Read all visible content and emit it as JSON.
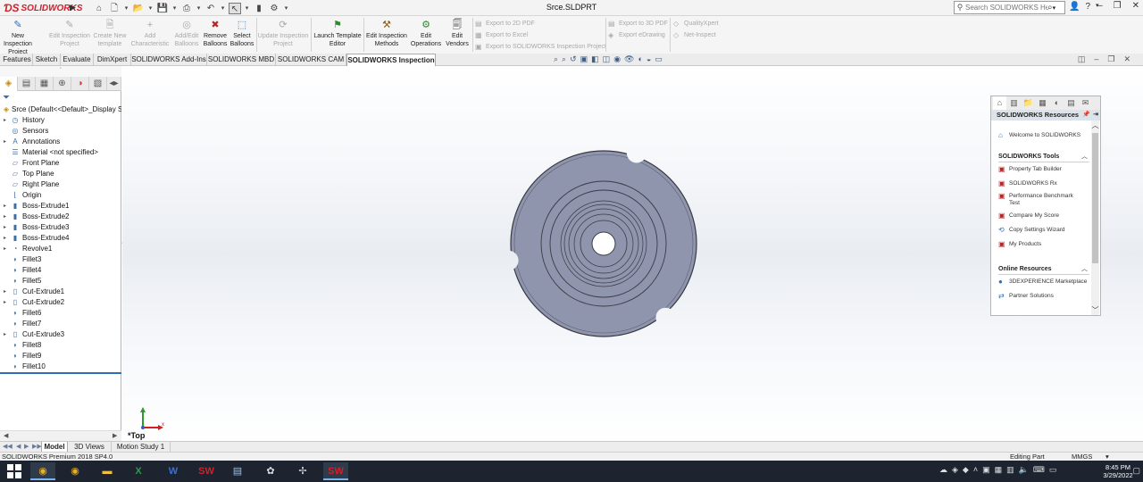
{
  "app": {
    "brand": "SOLIDWORKS",
    "document_title": "Srce.SLDPRT",
    "help_search_placeholder": "Search SOLIDWORKS Help",
    "title_icons": [
      "home-icon",
      "new-icon",
      "open-icon",
      "save-icon",
      "print-icon",
      "undo-icon",
      "select-icon",
      "rebuild-icon",
      "options-icon"
    ]
  },
  "command_manager": {
    "buttons": [
      {
        "label": "New Inspection Project",
        "enabled": true
      },
      {
        "label": "Edit Inspection Project",
        "enabled": false
      },
      {
        "label": "Create New template",
        "enabled": false
      },
      {
        "label": "Add Characteristic",
        "enabled": false
      },
      {
        "label": "Add/Edit Balloons",
        "enabled": false
      },
      {
        "label": "Remove Balloons",
        "enabled": true
      },
      {
        "label": "Select Balloons",
        "enabled": true
      },
      {
        "label": "Update Inspection Project",
        "enabled": false
      },
      {
        "label": "Launch Template Editor",
        "enabled": true
      },
      {
        "label": "Edit Inspection Methods",
        "enabled": true
      },
      {
        "label": "Edit Operations",
        "enabled": true
      },
      {
        "label": "Edit Vendors",
        "enabled": true
      }
    ],
    "export_items": [
      "Export to 2D PDF",
      "Export to Excel",
      "Export to SOLIDWORKS Inspection Project",
      "Export to 3D PDF",
      "Export eDrawing",
      "QualityXpert",
      "Net-Inspect"
    ]
  },
  "tabs": [
    {
      "label": "Features",
      "active": false
    },
    {
      "label": "Sketch",
      "active": false
    },
    {
      "label": "Evaluate",
      "active": false
    },
    {
      "label": "DimXpert",
      "active": false
    },
    {
      "label": "SOLIDWORKS Add-Ins",
      "active": false
    },
    {
      "label": "SOLIDWORKS MBD",
      "active": false
    },
    {
      "label": "SOLIDWORKS CAM",
      "active": false
    },
    {
      "label": "SOLIDWORKS Inspection",
      "active": true
    }
  ],
  "feature_tree": {
    "root": "Srce  (Default<<Default>_Display St",
    "items": [
      {
        "label": "History",
        "expandable": true,
        "icon": "history-icon"
      },
      {
        "label": "Sensors",
        "expandable": false,
        "icon": "sensor-icon"
      },
      {
        "label": "Annotations",
        "expandable": true,
        "icon": "annotation-icon"
      },
      {
        "label": "Material <not specified>",
        "expandable": false,
        "icon": "material-icon"
      },
      {
        "label": "Front Plane",
        "expandable": false,
        "icon": "plane-icon"
      },
      {
        "label": "Top Plane",
        "expandable": false,
        "icon": "plane-icon"
      },
      {
        "label": "Right Plane",
        "expandable": false,
        "icon": "plane-icon"
      },
      {
        "label": "Origin",
        "expandable": false,
        "icon": "origin-icon"
      },
      {
        "label": "Boss-Extrude1",
        "expandable": true,
        "icon": "extrude-icon"
      },
      {
        "label": "Boss-Extrude2",
        "expandable": true,
        "icon": "extrude-icon"
      },
      {
        "label": "Boss-Extrude3",
        "expandable": true,
        "icon": "extrude-icon"
      },
      {
        "label": "Boss-Extrude4",
        "expandable": true,
        "icon": "extrude-icon"
      },
      {
        "label": "Revolve1",
        "expandable": true,
        "icon": "revolve-icon"
      },
      {
        "label": "Fillet3",
        "expandable": false,
        "icon": "fillet-icon"
      },
      {
        "label": "Fillet4",
        "expandable": false,
        "icon": "fillet-icon"
      },
      {
        "label": "Fillet5",
        "expandable": false,
        "icon": "fillet-icon"
      },
      {
        "label": "Cut-Extrude1",
        "expandable": true,
        "icon": "cut-icon"
      },
      {
        "label": "Cut-Extrude2",
        "expandable": true,
        "icon": "cut-icon"
      },
      {
        "label": "Fillet6",
        "expandable": false,
        "icon": "fillet-icon"
      },
      {
        "label": "Fillet7",
        "expandable": false,
        "icon": "fillet-icon"
      },
      {
        "label": "Cut-Extrude3",
        "expandable": true,
        "icon": "cut-icon"
      },
      {
        "label": "Fillet8",
        "expandable": false,
        "icon": "fillet-icon"
      },
      {
        "label": "Fillet9",
        "expandable": false,
        "icon": "fillet-icon"
      },
      {
        "label": "Fillet10",
        "expandable": false,
        "icon": "fillet-icon"
      }
    ]
  },
  "graphics": {
    "view_name": "*Top",
    "part_color": "#8f95ad"
  },
  "task_pane": {
    "title": "SOLIDWORKS Resources",
    "welcome": "Welcome to SOLIDWORKS",
    "tools_heading": "SOLIDWORKS Tools",
    "tools": [
      "Property Tab Builder",
      "SOLIDWORKS Rx",
      "Performance Benchmark Test",
      "Compare My Score",
      "Copy Settings Wizard",
      "My Products"
    ],
    "online_heading": "Online Resources",
    "online": [
      "3DEXPERIENCE Marketplace",
      "Partner Solutions"
    ]
  },
  "bottom_tabs": [
    {
      "label": "Model",
      "active": true
    },
    {
      "label": "3D Views",
      "active": false
    },
    {
      "label": "Motion Study 1",
      "active": false
    }
  ],
  "status": {
    "version": "SOLIDWORKS Premium 2018 SP4.0",
    "mode": "Editing Part",
    "units": "MMGS"
  },
  "taskbar": {
    "time": "8:45 PM",
    "date": "3/29/2022"
  },
  "colors": {
    "accent": "#2d6cb7",
    "brand_red": "#d0212a",
    "taskbar": "#1d2430"
  }
}
